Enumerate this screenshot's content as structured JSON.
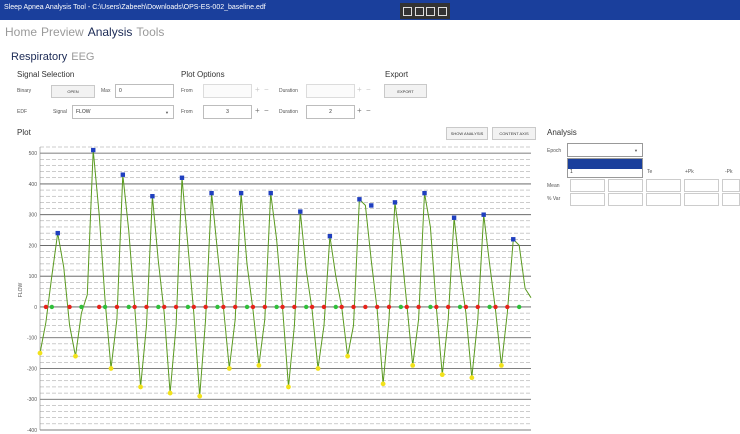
{
  "window": {
    "title": "Sleep Apnea Analysis Tool - C:\\Users\\Zabeeh\\Downloads\\OPS-ES-002_baseline.edf"
  },
  "nav": {
    "home": "Home",
    "preview": "Preview",
    "analysis": "Analysis",
    "tools": "Tools"
  },
  "subnav": {
    "respiratory": "Respiratory",
    "eeg": "EEG"
  },
  "signal_selection": {
    "title": "Signal Selection",
    "binary_label": "Binary",
    "open_label": "OPEN",
    "max_label": "Max",
    "max_value": "0",
    "edf_label": "EDF",
    "signal_label": "Signal",
    "signal_value": "FLOW"
  },
  "plot_options": {
    "title": "Plot Options",
    "from_label": "From",
    "duration_label": "Duration",
    "from2_value": "3",
    "duration2_value": "2",
    "plus": "+",
    "minus": "−"
  },
  "export": {
    "title": "Export",
    "button": "EXPORT"
  },
  "plot": {
    "title": "Plot",
    "show_analysis": "SHOW ANALYSIS",
    "content_axis": "CONTENT AXIS",
    "ylabel": "FLOW"
  },
  "analysis": {
    "title": "Analysis",
    "epoch_label": "Epoch",
    "epoch_option": "1",
    "columns": [
      "Te",
      "+Pk",
      "-Pk"
    ],
    "rows": [
      "Mean",
      "% Var"
    ]
  },
  "colors": {
    "titlebar": "#1a3f9c",
    "signal": "#5a9a1f",
    "peak_marker": "#1f3fbf",
    "trough_marker": "#f2e21b",
    "zero_red": "#e6231a",
    "zero_green": "#2fbf3a",
    "accent": "#1b2a55"
  },
  "chart_data": {
    "type": "line",
    "title": "",
    "xlabel": "",
    "ylabel": "FLOW",
    "ylim": [
      -400,
      520
    ],
    "y_ticks": [
      500,
      400,
      300,
      200,
      100,
      0,
      -100,
      -200,
      -300,
      -400
    ],
    "grid": true,
    "series": [
      {
        "values": [
          -150,
          -50,
          100,
          240,
          130,
          -60,
          -160,
          -20,
          40,
          510,
          300,
          20,
          -200,
          -40,
          430,
          250,
          0,
          -260,
          -60,
          360,
          150,
          -20,
          -280,
          -60,
          420,
          200,
          -20,
          -290,
          -40,
          370,
          180,
          0,
          -200,
          -40,
          370,
          140,
          -10,
          -190,
          -40,
          370,
          220,
          0,
          -260,
          -60,
          310,
          120,
          -10,
          -200,
          -60,
          230,
          100,
          0,
          -160,
          -60,
          350,
          330,
          150,
          -10,
          -250,
          -40,
          340,
          200,
          10,
          -190,
          -40,
          370,
          260,
          0,
          -220,
          -40,
          290,
          120,
          -20,
          -230,
          -40,
          300,
          140,
          -10,
          -190,
          -20,
          220,
          200,
          60,
          30
        ]
      }
    ],
    "peaks": [
      {
        "x": 3,
        "y": 240
      },
      {
        "x": 9,
        "y": 510
      },
      {
        "x": 14,
        "y": 430
      },
      {
        "x": 19,
        "y": 360
      },
      {
        "x": 24,
        "y": 420
      },
      {
        "x": 29,
        "y": 370
      },
      {
        "x": 34,
        "y": 370
      },
      {
        "x": 39,
        "y": 370
      },
      {
        "x": 44,
        "y": 310
      },
      {
        "x": 49,
        "y": 230
      },
      {
        "x": 54,
        "y": 350
      },
      {
        "x": 56,
        "y": 330
      },
      {
        "x": 60,
        "y": 340
      },
      {
        "x": 65,
        "y": 370
      },
      {
        "x": 70,
        "y": 290
      },
      {
        "x": 75,
        "y": 300
      },
      {
        "x": 80,
        "y": 220
      }
    ],
    "troughs": [
      {
        "x": 0,
        "y": -150
      },
      {
        "x": 6,
        "y": -160
      },
      {
        "x": 12,
        "y": -200
      },
      {
        "x": 17,
        "y": -260
      },
      {
        "x": 22,
        "y": -280
      },
      {
        "x": 27,
        "y": -290
      },
      {
        "x": 32,
        "y": -200
      },
      {
        "x": 37,
        "y": -190
      },
      {
        "x": 42,
        "y": -260
      },
      {
        "x": 47,
        "y": -200
      },
      {
        "x": 52,
        "y": -160
      },
      {
        "x": 58,
        "y": -250
      },
      {
        "x": 63,
        "y": -190
      },
      {
        "x": 68,
        "y": -220
      },
      {
        "x": 73,
        "y": -230
      },
      {
        "x": 78,
        "y": -190
      }
    ],
    "zero_red_x": [
      1,
      5,
      10,
      13,
      16,
      18,
      21,
      23,
      26,
      28,
      31,
      33,
      36,
      38,
      41,
      43,
      46,
      48,
      51,
      53,
      55,
      57,
      59,
      62,
      64,
      67,
      69,
      72,
      74,
      77,
      79
    ],
    "zero_green_x": [
      2,
      7,
      11,
      15,
      20,
      25,
      30,
      35,
      40,
      45,
      50,
      61,
      66,
      71,
      76,
      81
    ]
  }
}
